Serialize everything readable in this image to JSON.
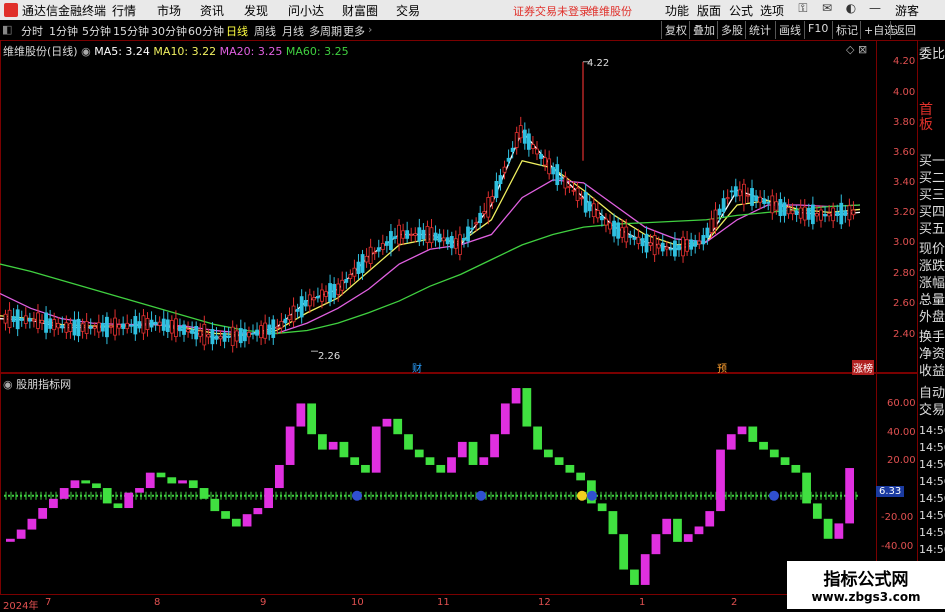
{
  "app": {
    "title": "通达信金融终端",
    "accent": "#e0302a"
  },
  "menu": [
    "行情",
    "市场",
    "资讯",
    "发现",
    "问小达",
    "财富圈",
    "交易"
  ],
  "menu_warning": [
    "证券交易未登录",
    "维维股份"
  ],
  "menu_right": [
    "功能",
    "版面",
    "公式",
    "选项"
  ],
  "guest": "游客",
  "toolbar_left": [
    "分时",
    "1分钟",
    "5分钟",
    "15分钟",
    "30分钟",
    "60分钟",
    "日线",
    "周线",
    "月线",
    "多周期",
    "更多"
  ],
  "toolbar_right": [
    "复权",
    "叠加",
    "多股",
    "统计",
    "画线",
    "F10",
    "标记",
    "+自选",
    "返回"
  ],
  "chart_header": {
    "name": "维维股份(日线)",
    "ma5": "MA5: 3.24",
    "ma10": "MA10: 3.22",
    "ma20": "MA20: 3.25",
    "ma60": "MA60: 3.25"
  },
  "price_axis": [
    "4.20",
    "4.00",
    "3.80",
    "3.60",
    "3.40",
    "3.20",
    "3.00",
    "2.80",
    "2.60",
    "2.40"
  ],
  "annotations": {
    "high": "4.22",
    "low": "2.26",
    "cai": "财",
    "yu": "预",
    "zhang": "涨榜"
  },
  "indicator": {
    "name": "股朋指标网",
    "value_tag": "6.33"
  },
  "ind_axis": [
    "60.00",
    "40.00",
    "20.00",
    "-20.00",
    "-40.00"
  ],
  "right_panel": [
    "委比",
    "首板",
    "买一",
    "买二",
    "买三",
    "买四",
    "买五",
    "现价",
    "涨跌",
    "涨幅",
    "总量",
    "外盘",
    "换手",
    "净资",
    "收益",
    "自动",
    "交易"
  ],
  "right_times": [
    "14:56",
    "14:56",
    "14:56",
    "14:56",
    "14:56",
    "14:56",
    "14:56",
    "14:56"
  ],
  "x_labels": [
    "2024年",
    "7",
    "8",
    "9",
    "10",
    "11",
    "12",
    "1",
    "2"
  ],
  "watermark": {
    "line1": "指标公式网",
    "line2": "www.zbgs3.com"
  },
  "chart_data": [
    {
      "type": "line",
      "title": "维维股份(日线)",
      "ylim": [
        2.2,
        4.3
      ],
      "series": [
        {
          "name": "MA5",
          "color": "#ffffff",
          "values": [
            2.48,
            2.47,
            2.42,
            2.42,
            2.43,
            2.45,
            2.4,
            2.35,
            2.37,
            2.42,
            2.6,
            2.68,
            2.9,
            3.05,
            3.05,
            2.98,
            3.25,
            3.75,
            3.5,
            3.3,
            3.1,
            3.0,
            2.95,
            3.0,
            3.35,
            3.28,
            3.2,
            3.18,
            3.2
          ]
        },
        {
          "name": "MA10",
          "color": "#f0f060",
          "values": [
            2.5,
            2.48,
            2.44,
            2.43,
            2.43,
            2.44,
            2.42,
            2.38,
            2.37,
            2.4,
            2.52,
            2.62,
            2.8,
            2.98,
            3.02,
            3.0,
            3.15,
            3.55,
            3.5,
            3.35,
            3.18,
            3.05,
            2.98,
            3.0,
            3.25,
            3.28,
            3.22,
            3.2,
            3.22
          ]
        },
        {
          "name": "MA20",
          "color": "#e060e0",
          "values": [
            2.65,
            2.55,
            2.48,
            2.45,
            2.44,
            2.44,
            2.43,
            2.4,
            2.38,
            2.38,
            2.45,
            2.55,
            2.68,
            2.85,
            2.95,
            2.98,
            3.05,
            3.3,
            3.42,
            3.4,
            3.25,
            3.1,
            3.02,
            3.0,
            3.15,
            3.25,
            3.25,
            3.24,
            3.25
          ]
        },
        {
          "name": "MA60",
          "color": "#40d040",
          "values": [
            2.85,
            2.8,
            2.74,
            2.68,
            2.62,
            2.56,
            2.5,
            2.44,
            2.4,
            2.38,
            2.4,
            2.45,
            2.52,
            2.6,
            2.7,
            2.78,
            2.88,
            2.98,
            3.05,
            3.1,
            3.12,
            3.13,
            3.14,
            3.15,
            3.18,
            3.2,
            3.22,
            3.24,
            3.25
          ]
        }
      ]
    },
    {
      "type": "bar",
      "title": "股朋指标网",
      "ylim": [
        -60,
        72
      ],
      "values": [
        -28,
        -22,
        -15,
        -8,
        -2,
        5,
        10,
        8,
        5,
        -5,
        -8,
        2,
        5,
        15,
        12,
        8,
        10,
        5,
        -2,
        -10,
        -15,
        -20,
        -12,
        -8,
        5,
        20,
        45,
        60,
        40,
        30,
        35,
        25,
        20,
        15,
        45,
        50,
        40,
        30,
        25,
        20,
        15,
        25,
        35,
        20,
        25,
        40,
        60,
        70,
        45,
        30,
        25,
        20,
        15,
        10,
        -5,
        -10,
        -25,
        -48,
        -58,
        -38,
        -25,
        -15,
        -30,
        -25,
        -20,
        -10,
        30,
        40,
        45,
        35,
        30,
        25,
        20,
        15,
        -5,
        -15,
        -28,
        -18,
        18
      ]
    }
  ]
}
